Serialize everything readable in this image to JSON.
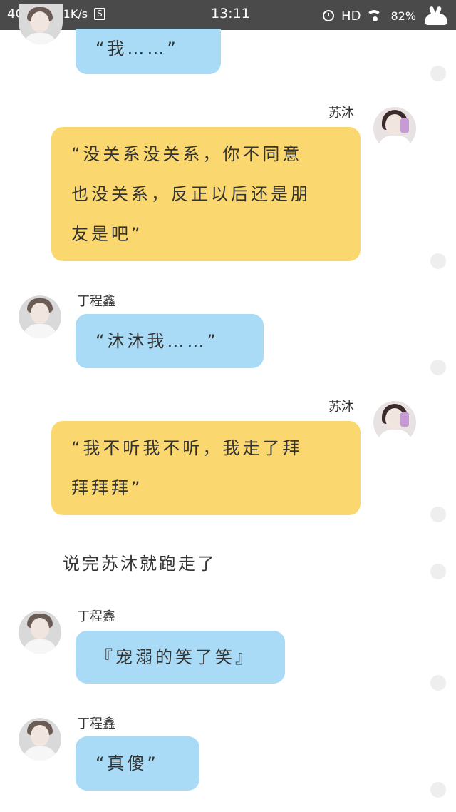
{
  "status_bar": {
    "network": "4G",
    "speed": "0.1K/s",
    "sim_badge": "S",
    "time": "13:11",
    "hd": "HD",
    "battery": "82%"
  },
  "characters": {
    "su_mu": "苏沐",
    "ding_chengxin": "丁程鑫"
  },
  "messages": [
    {
      "text": "“我……”"
    },
    {
      "name": "苏沐",
      "text": "“没关系没关系，你不同意\n也没关系，反正以后还是朋\n友是吧”"
    },
    {
      "name": "丁程鑫",
      "text": "“沐沐我……”"
    },
    {
      "name": "苏沐",
      "text": "“我不听我不听，我走了拜\n拜拜拜”"
    },
    {
      "name": "丁程鑫",
      "text": "『宠溺的笑了笑』"
    },
    {
      "name": "丁程鑫",
      "text": "“真傻”"
    }
  ],
  "narration": "说完苏沐就跑走了",
  "colors": {
    "blue_bubble": "#a9dbf7",
    "yellow_bubble": "#fbd86f",
    "status_bar": "#4a4a4a"
  },
  "icons": [
    "signal-icon",
    "sim-icon",
    "alarm-clock-icon",
    "wifi-icon",
    "bunny-icon",
    "avatar"
  ]
}
